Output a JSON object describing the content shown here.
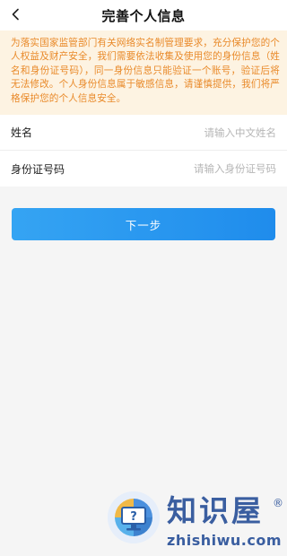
{
  "header": {
    "back_icon": "chevron-left-icon",
    "title": "完善个人信息"
  },
  "notice": {
    "text": "为落实国家监管部门有关网络实名制管理要求，充分保护您的个人权益及财产安全，我们需要依法收集及使用您的身份信息（姓名和身份证号码），同一身份信息只能验证一个账号，验证后将无法修改。个人身份信息属于敏感信息，请谨慎提供，我们将严格保护您的个人信息安全。",
    "text_color": "#e98a2a",
    "background": "#fdf3e2"
  },
  "form": {
    "name": {
      "label": "姓名",
      "value": "",
      "placeholder": "请输入中文姓名"
    },
    "id_number": {
      "label": "身份证号码",
      "value": "",
      "placeholder": "请输入身份证号码"
    }
  },
  "next_button": {
    "label": "下一步",
    "color": "#2196f0"
  },
  "watermark": {
    "brand": "知识屋",
    "registered": "®",
    "domain": "zhishiwu.com",
    "logo_icon": "monitor-question-icon",
    "color": "#3a5ea0"
  }
}
